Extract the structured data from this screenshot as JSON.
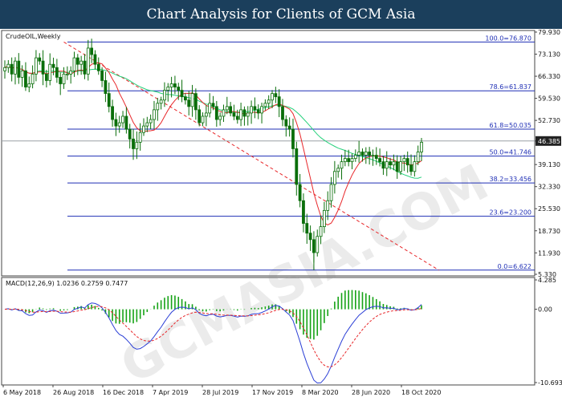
{
  "header": {
    "title": "Chart Analysis for Clients of GCM Asia"
  },
  "colors": {
    "header_bg": "#1b3f5c",
    "candle": "#0a6e0a",
    "ma_fast": "#e8272a",
    "ma_slow": "#27d17c",
    "fib_line": "#1f2fb5",
    "trend_line": "#e8272a",
    "price_line": "#9aa0a6",
    "macd_line": "#2b3fd6",
    "signal_line": "#e8272a",
    "histogram": "#16a316"
  },
  "chart_data": [
    {
      "type": "candlestick",
      "title": "CrudeOIL,Weekly",
      "y_axis_ticks": [
        "79.930",
        "73.130",
        "66.330",
        "59.530",
        "52.730",
        "46.385",
        "39.130",
        "32.330",
        "25.530",
        "18.730",
        "11.930",
        "5.330"
      ],
      "ylim": [
        5.33,
        79.93
      ],
      "x_tick_labels": [
        "6 May 2018",
        "26 Aug 2018",
        "16 Dec 2018",
        "7 Apr 2019",
        "28 Jul 2019",
        "17 Nov 2019",
        "8 Mar 2020",
        "28 Jun 2020",
        "18 Oct 2020"
      ],
      "current_price": 46.385,
      "fib_levels": [
        {
          "label": "100.0=76.870",
          "value": 76.87
        },
        {
          "label": "78.6=61.837",
          "value": 61.837
        },
        {
          "label": "61.8=50.035",
          "value": 50.035
        },
        {
          "label": "50.0=41.746",
          "value": 41.746
        },
        {
          "label": "38.2=33.456",
          "value": 33.456
        },
        {
          "label": "23.6=23.200",
          "value": 23.2
        },
        {
          "label": "0.0=6.622",
          "value": 6.622
        }
      ],
      "trend_line": {
        "from": {
          "week": 17,
          "value": 76.87
        },
        "to": {
          "week": 125,
          "value": 6.622
        }
      },
      "ohlc_weekly_close": [
        69,
        70,
        67,
        71,
        66,
        68,
        63,
        64,
        67,
        72,
        71,
        67,
        65,
        70,
        69,
        66,
        64,
        67,
        67,
        68,
        72,
        70,
        71,
        67,
        75,
        73,
        70,
        68,
        65,
        61,
        57,
        53,
        51,
        52,
        54,
        50,
        47,
        44,
        46,
        49,
        51,
        52,
        53,
        56,
        58,
        59,
        62,
        63,
        64,
        63,
        62,
        60,
        59,
        57,
        61,
        56,
        52,
        54,
        55,
        58,
        57,
        53,
        54,
        56,
        57,
        55,
        54,
        53,
        56,
        54,
        55,
        57,
        56,
        55,
        57,
        58,
        59,
        61,
        60,
        57,
        53,
        51,
        50,
        44,
        33,
        28,
        21,
        18,
        16,
        12,
        17,
        20,
        25,
        28,
        33,
        37,
        38,
        40,
        41,
        40,
        41,
        42,
        43,
        42,
        43,
        42,
        42,
        41,
        40,
        38,
        40,
        39,
        40,
        37,
        40,
        41,
        39,
        37,
        40,
        43,
        46
      ]
    },
    {
      "type": "line",
      "title": "MACD(12,26,9) 1.0236 0.2759 0.7477",
      "y_axis_ticks": [
        "4.285",
        "0.00",
        "-10.693"
      ],
      "ylim": [
        -10.693,
        4.285
      ]
    }
  ]
}
